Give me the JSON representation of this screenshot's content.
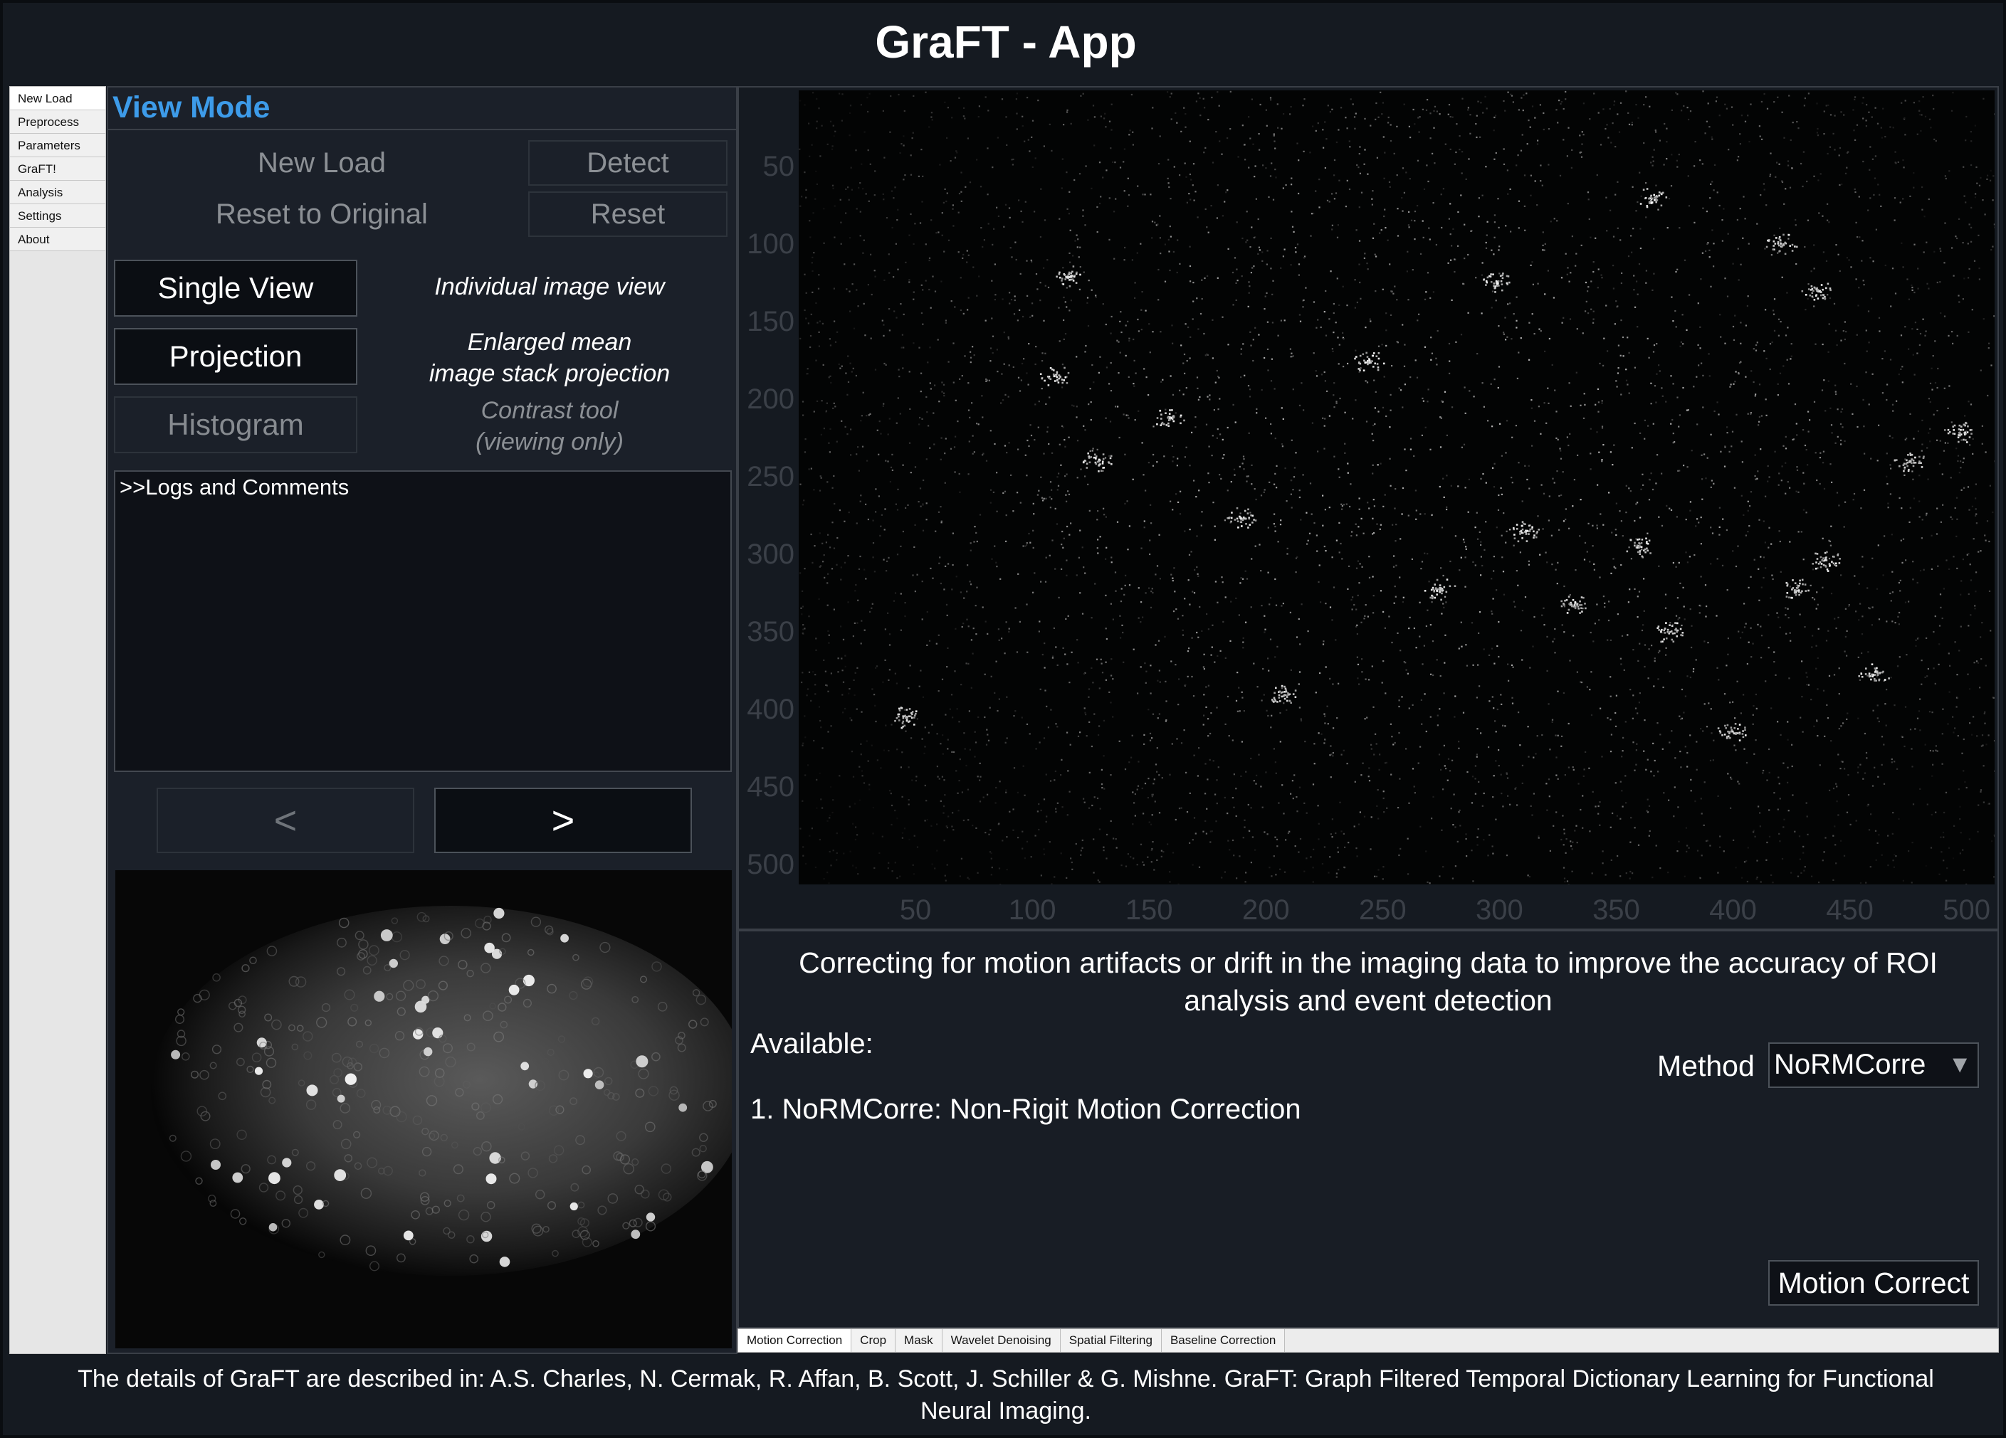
{
  "app": {
    "title": "GraFT - App"
  },
  "side_nav": {
    "items": [
      {
        "label": "New Load"
      },
      {
        "label": "Preprocess"
      },
      {
        "label": "Parameters"
      },
      {
        "label": "GraFT!"
      },
      {
        "label": "Analysis"
      },
      {
        "label": "Settings"
      },
      {
        "label": "About"
      }
    ],
    "active": "New Load"
  },
  "view_mode": {
    "title": "View Mode",
    "new_load_label": "New Load",
    "detect_label": "Detect",
    "reset_to_original_label": "Reset to Original",
    "reset_label": "Reset",
    "single_view": {
      "label": "Single View",
      "description": "Individual image view"
    },
    "projection": {
      "label": "Projection",
      "description_line1": "Enlarged mean",
      "description_line2": "image stack projection"
    },
    "histogram": {
      "label": "Histogram",
      "description_line1": "Contrast tool",
      "description_line2": "(viewing only)"
    },
    "logs_text": ">>Logs and Comments",
    "prev_label": "<",
    "next_label": ">"
  },
  "plot": {
    "y_ticks": [
      "50",
      "100",
      "150",
      "200",
      "250",
      "300",
      "350",
      "400",
      "450",
      "500"
    ],
    "x_ticks": [
      "50",
      "100",
      "150",
      "200",
      "250",
      "300",
      "350",
      "400",
      "450",
      "500"
    ]
  },
  "preprocess": {
    "description": "Correcting for motion artifacts or drift in the imaging data to improve the accuracy of ROI analysis and event detection",
    "available_label": "Available:",
    "method_item": "1. NoRMCorre: Non-Rigit Motion Correction",
    "method_label": "Method",
    "method_selected": "NoRMCorre",
    "run_label": "Motion Correct"
  },
  "tabs": [
    {
      "label": "Motion Correction"
    },
    {
      "label": "Crop"
    },
    {
      "label": "Mask"
    },
    {
      "label": "Wavelet Denoising"
    },
    {
      "label": "Spatial Filtering"
    },
    {
      "label": "Baseline Correction"
    }
  ],
  "footer": {
    "line1": "The details of GraFT are described in: A.S. Charles, N. Cermak, R. Affan, B. Scott, J. Schiller & G. Mishne. GraFT: Graph Filtered Temporal Dictionary Learning for Functional",
    "line2": "Neural Imaging."
  }
}
